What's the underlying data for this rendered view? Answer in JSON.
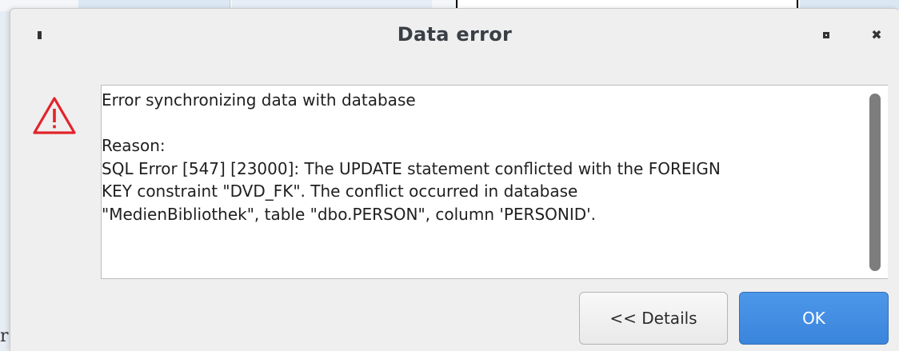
{
  "background": {
    "cut_char": "r"
  },
  "dialog": {
    "title": "Data error",
    "message_lines": [
      "Error synchronizing data with database",
      "",
      "Reason:",
      "SQL Error [547] [23000]: The UPDATE statement conflicted with the FOREIGN",
      "KEY constraint \"DVD_FK\". The conflict occurred in database",
      "\"MedienBibliothek\", table \"dbo.PERSON\", column 'PERSONID'."
    ],
    "buttons": {
      "details_label": "<< Details",
      "ok_label": "OK"
    },
    "icons": {
      "menu": "window-menu-icon",
      "maximize": "maximize-icon",
      "close": "close-icon",
      "warning": "warning-triangle-icon"
    },
    "colors": {
      "warning": "#e2242b",
      "ok_button": "#3a85dc",
      "title_text": "#3a3f46"
    }
  }
}
